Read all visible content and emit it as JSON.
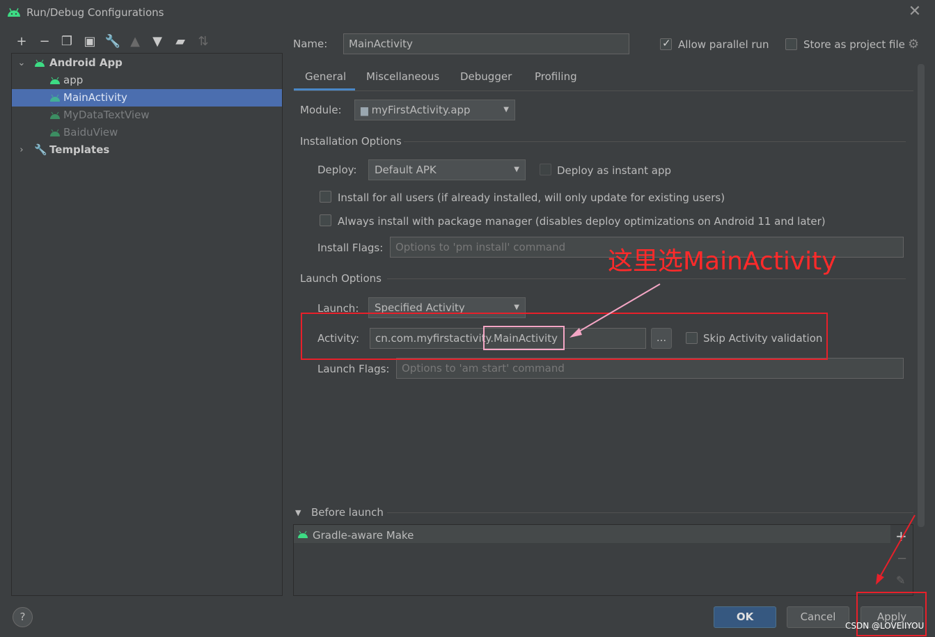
{
  "window": {
    "title": "Run/Debug Configurations"
  },
  "toolbar": {
    "icons": [
      "add-icon",
      "remove-icon",
      "copy-icon",
      "save-icon",
      "wrench-icon",
      "move-up-icon",
      "move-down-icon",
      "new-folder-icon",
      "sort-icon"
    ]
  },
  "tree": {
    "group": "Android App",
    "items": [
      "app",
      "MainActivity",
      "MyDataTextView",
      "BaiduView"
    ],
    "templates": "Templates"
  },
  "form": {
    "name_label": "Name:",
    "name_value": "MainActivity",
    "allow_parallel": "Allow parallel run",
    "store_project": "Store as project file",
    "tabs": [
      "General",
      "Miscellaneous",
      "Debugger",
      "Profiling"
    ],
    "module_label": "Module:",
    "module_value": "myFirstActivity.app",
    "installation_title": "Installation Options",
    "deploy_label": "Deploy:",
    "deploy_value": "Default APK",
    "instant_app": "Deploy as instant app",
    "install_all_users": "Install for all users (if already installed, will only update for existing users)",
    "always_install": "Always install with package manager (disables deploy optimizations on Android 11 and later)",
    "install_flags_label": "Install Flags:",
    "install_flags_placeholder": "Options to 'pm install' command",
    "launch_title": "Launch Options",
    "launch_label": "Launch:",
    "launch_value": "Specified Activity",
    "activity_label": "Activity:",
    "activity_prefix": "cn.com.myfirstactivity",
    "activity_class": ".MainActivity",
    "browse": "...",
    "skip_validation": "Skip Activity validation",
    "launch_flags_label": "Launch Flags:",
    "launch_flags_placeholder": "Options to 'am start' command",
    "before_launch": "Before launch",
    "gradle_task": "Gradle-aware Make"
  },
  "buttons": {
    "ok": "OK",
    "cancel": "Cancel",
    "apply": "Apply",
    "help": "?"
  },
  "annotation": {
    "text": "这里选MainActivity"
  },
  "watermark": "CSDN @LOVEIIYOU",
  "colors": {
    "accent": "#4b6eaf",
    "annotation_red": "#e8202a",
    "highlight_pink": "#f4a6c5",
    "android_green": "#3ddc84"
  }
}
